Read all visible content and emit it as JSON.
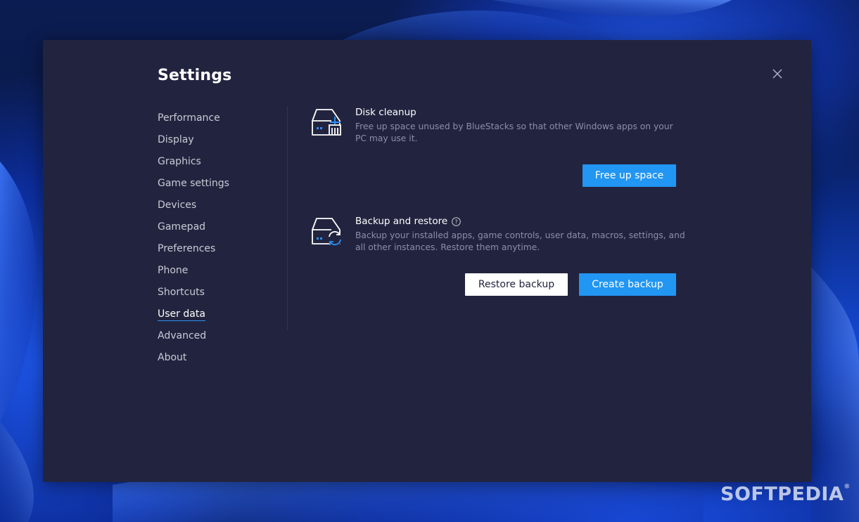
{
  "colors": {
    "dialog_bg": "#22243f",
    "accent": "#2196f3",
    "nav_text": "#c9cad6",
    "description_text": "#8d8fa6"
  },
  "dialog": {
    "title": "Settings",
    "close_icon": "close-icon"
  },
  "nav": {
    "items": [
      {
        "label": "Performance",
        "active": false
      },
      {
        "label": "Display",
        "active": false
      },
      {
        "label": "Graphics",
        "active": false
      },
      {
        "label": "Game settings",
        "active": false
      },
      {
        "label": "Devices",
        "active": false
      },
      {
        "label": "Gamepad",
        "active": false
      },
      {
        "label": "Preferences",
        "active": false
      },
      {
        "label": "Phone",
        "active": false
      },
      {
        "label": "Shortcuts",
        "active": false
      },
      {
        "label": "User data",
        "active": true
      },
      {
        "label": "Advanced",
        "active": false
      },
      {
        "label": "About",
        "active": false
      }
    ]
  },
  "disk_cleanup": {
    "icon": "disk-cleanup-icon",
    "title": "Disk cleanup",
    "description": "Free up space unused by BlueStacks so that other Windows apps on your PC may use it.",
    "button_label": "Free up space"
  },
  "backup_restore": {
    "icon": "backup-restore-icon",
    "title": "Backup and restore",
    "help_icon": "question-circle-icon",
    "description": "Backup your installed apps, game controls, user data, macros, settings, and all other instances. Restore them anytime.",
    "restore_label": "Restore backup",
    "create_label": "Create backup"
  },
  "watermark": {
    "text": "SOFTPEDIA",
    "mark": "®"
  }
}
